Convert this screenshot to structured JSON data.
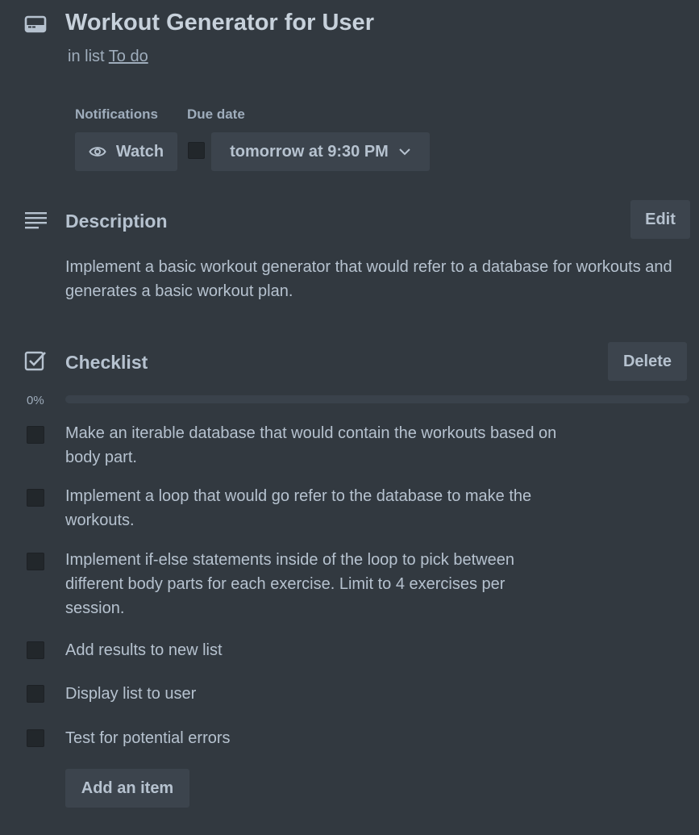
{
  "card": {
    "title": "Workout Generator for User",
    "in_list_prefix": "in list",
    "list_name": "To do"
  },
  "notifications": {
    "label": "Notifications",
    "watch_label": "Watch",
    "watch_icon": "eye-icon"
  },
  "due_date": {
    "label": "Due date",
    "value": "tomorrow at 9:30 PM",
    "checked": false
  },
  "description": {
    "heading": "Description",
    "edit_label": "Edit",
    "text": "Implement a basic workout generator that would refer to a database for workouts and generates a basic workout plan."
  },
  "checklist": {
    "heading": "Checklist",
    "delete_label": "Delete",
    "progress_label": "0%",
    "progress": 0,
    "items": [
      {
        "text": "Make an iterable database that would contain the workouts based on body part.",
        "checked": false
      },
      {
        "text": "Implement a loop that would go refer to the database to make the workouts.",
        "checked": false
      },
      {
        "text": "Implement if-else statements inside of the loop to pick between different body parts for each exercise. Limit to 4 exercises per session.",
        "checked": false
      },
      {
        "text": "Add results to new list",
        "checked": false
      },
      {
        "text": "Display list to user",
        "checked": false
      },
      {
        "text": "Test for potential errors",
        "checked": false
      }
    ],
    "add_item_label": "Add an item"
  },
  "colors": {
    "background": "#323940",
    "button": "#3c444d",
    "text": "#b6c2cf"
  }
}
